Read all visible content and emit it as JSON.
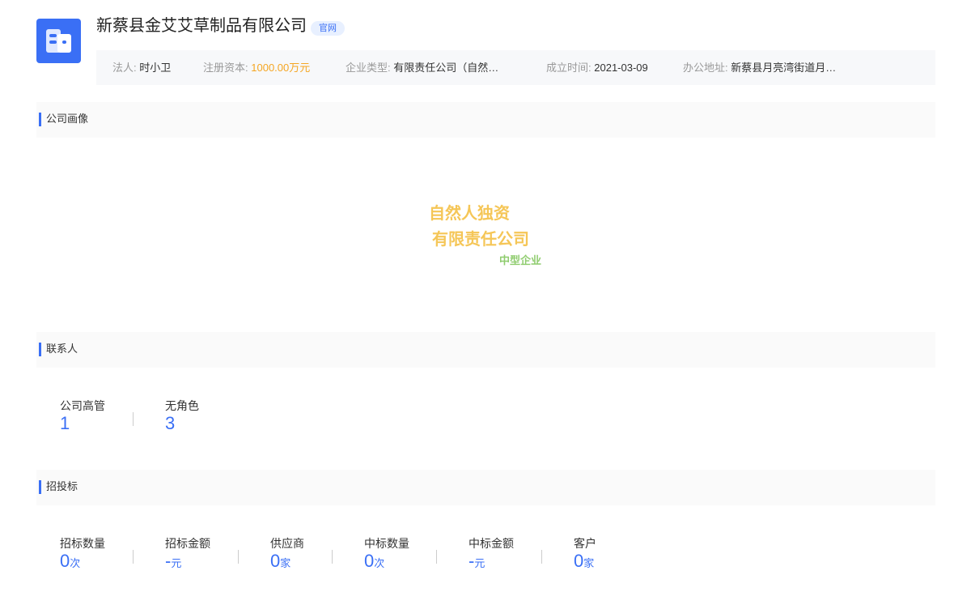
{
  "company": {
    "name": "新蔡县金艾艾草制品有限公司",
    "badge": "官网",
    "logo_icon": "building-icon",
    "brand_color": "#3a6ff5"
  },
  "info": {
    "legal_person_label": "法人:",
    "legal_person": "时小卫",
    "capital_label": "注册资本:",
    "capital": "1000.00万元",
    "type_label": "企业类型:",
    "type": "有限责任公司（自然…",
    "founded_label": "成立时间:",
    "founded": "2021-03-09",
    "address_label": "办公地址:",
    "address": "新蔡县月亮湾街道月…"
  },
  "portrait": {
    "title": "公司画像",
    "tags": [
      "自然人独资",
      "有限责任公司",
      "中型企业"
    ]
  },
  "contacts": {
    "title": "联系人",
    "stats": [
      {
        "label": "公司高管",
        "value": "1"
      },
      {
        "label": "无角色",
        "value": "3"
      }
    ]
  },
  "bidding": {
    "title": "招投标",
    "stats": [
      {
        "label": "招标数量",
        "value": "0",
        "unit": "次"
      },
      {
        "label": "招标金额",
        "value": "-",
        "unit": "元"
      },
      {
        "label": "供应商",
        "value": "0",
        "unit": "家"
      },
      {
        "label": "中标数量",
        "value": "0",
        "unit": "次"
      },
      {
        "label": "中标金额",
        "value": "-",
        "unit": "元"
      },
      {
        "label": "客户",
        "value": "0",
        "unit": "家"
      }
    ]
  }
}
